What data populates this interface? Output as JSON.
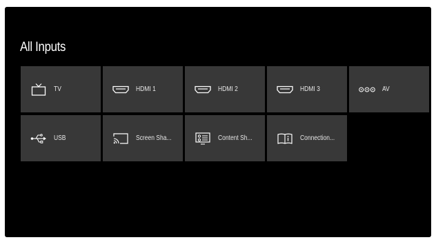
{
  "page": {
    "title": "All Inputs"
  },
  "inputs": [
    {
      "label": "TV",
      "icon": "tv-icon"
    },
    {
      "label": "HDMI 1",
      "icon": "hdmi-icon"
    },
    {
      "label": "HDMI 2",
      "icon": "hdmi-icon"
    },
    {
      "label": "HDMI 3",
      "icon": "hdmi-icon"
    },
    {
      "label": "AV",
      "icon": "av-icon"
    },
    {
      "label": "USB",
      "icon": "usb-icon"
    },
    {
      "label": "Screen Sha...",
      "icon": "screen-share-icon"
    },
    {
      "label": "Content Sh...",
      "icon": "content-share-icon"
    },
    {
      "label": "Connection...",
      "icon": "connection-guide-icon"
    }
  ],
  "colors": {
    "background": "#000000",
    "tile": "#383838",
    "text": "#ffffff"
  }
}
